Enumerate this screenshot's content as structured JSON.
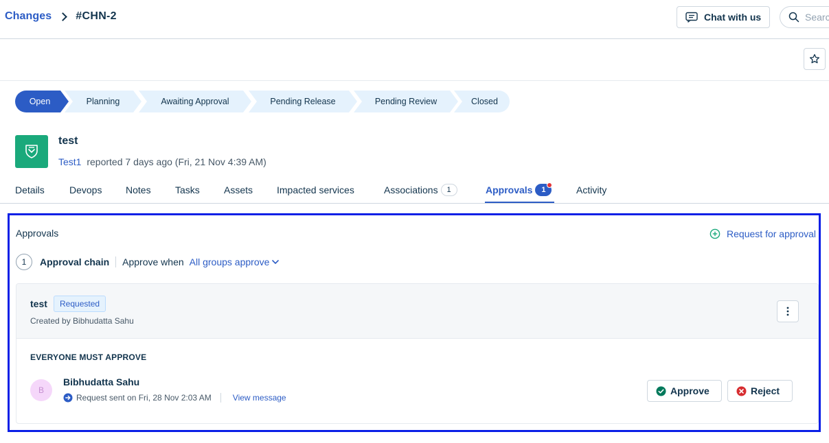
{
  "breadcrumb": {
    "parent": "Changes",
    "current": "#CHN-2"
  },
  "header": {
    "chat_label": "Chat with us",
    "search_placeholder": "Search"
  },
  "pipeline": {
    "stages": [
      "Open",
      "Planning",
      "Awaiting Approval",
      "Pending Release",
      "Pending Review",
      "Closed"
    ],
    "active_index": 0,
    "colors": {
      "active": "#2c5cc5",
      "inactive": "#e5f2fd"
    }
  },
  "ticket": {
    "title": "test",
    "reporter": "Test1",
    "reported_text": "reported 7 days ago (Fri, 21 Nov 4:39 AM)",
    "icon": "shield-icon",
    "icon_color": "#1aa97b"
  },
  "tabs": {
    "items": [
      {
        "label": "Details"
      },
      {
        "label": "Devops"
      },
      {
        "label": "Notes"
      },
      {
        "label": "Tasks"
      },
      {
        "label": "Assets"
      },
      {
        "label": "Impacted services"
      },
      {
        "label": "Associations",
        "count": "1"
      },
      {
        "label": "Approvals",
        "count": "1"
      },
      {
        "label": "Activity"
      }
    ],
    "active": "Approvals"
  },
  "approvals": {
    "title": "Approvals",
    "request_link": "Request for approval",
    "chain": {
      "number": "1",
      "label": "Approval chain",
      "approve_when_label": "Approve when",
      "approve_when_value": "All groups approve"
    },
    "group": {
      "name": "test",
      "status": "Requested",
      "created_by": "Created by Bibhudatta Sahu",
      "rule": "EVERYONE MUST APPROVE",
      "approver": {
        "initial": "B",
        "name": "Bibhudatta Sahu",
        "request_text": "Request sent on Fri, 28 Nov 2:03 AM",
        "view_message": "View message"
      },
      "approve_label": "Approve",
      "reject_label": "Reject"
    }
  }
}
